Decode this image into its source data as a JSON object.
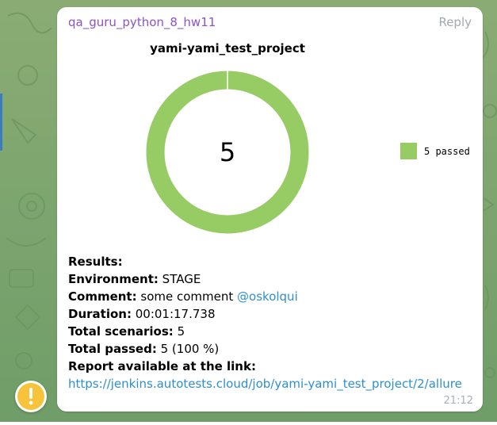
{
  "message": {
    "sender": "qa_guru_python_8_hw11",
    "reply_label": "Reply",
    "time": "21:12"
  },
  "chart_data": {
    "type": "pie",
    "title": "yami-yami_test_project",
    "center_text": "5",
    "slices": [
      {
        "label": "passed",
        "value": 5,
        "color": "#97cc64"
      }
    ],
    "legend": [
      {
        "label": "5 passed",
        "color": "#97cc64"
      }
    ],
    "legend_position": "right"
  },
  "results": {
    "heading": "Results:",
    "environment_label": "Environment:",
    "environment_value": "STAGE",
    "comment_label": "Comment:",
    "comment_value": "some comment",
    "comment_mention": "@oskolqui",
    "duration_label": "Duration:",
    "duration_value": "00:01:17.738",
    "total_scenarios_label": "Total scenarios:",
    "total_scenarios_value": "5",
    "total_passed_label": "Total passed:",
    "total_passed_value": "5 (100 %)",
    "report_label": "Report available at the link:",
    "report_link": "https://jenkins.autotests.cloud/job/yami-yami_test_project/2/allure"
  },
  "colors": {
    "sender": "#8e52c9",
    "link": "#2d8fd0",
    "passed": "#97cc64",
    "warning": "#f6c33a"
  },
  "icons": {
    "status": "warning-icon"
  }
}
